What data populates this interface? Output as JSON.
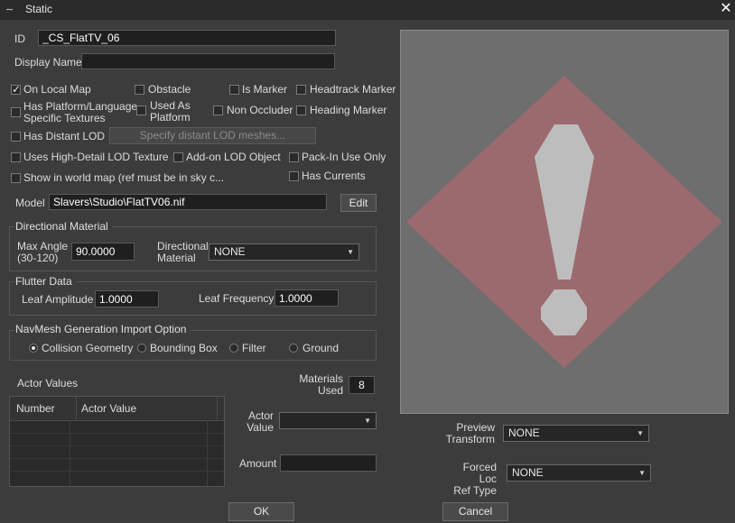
{
  "window": {
    "title": "Static",
    "close_glyph": "✕"
  },
  "form": {
    "id_label": "ID",
    "id_value": "_CS_FlatTV_06",
    "display_name_label": "Display Name",
    "display_name_value": ""
  },
  "checkboxes": {
    "on_local_map": {
      "label": "On Local Map",
      "checked": true
    },
    "obstacle": {
      "label": "Obstacle",
      "checked": false
    },
    "is_marker": {
      "label": "Is Marker",
      "checked": false
    },
    "headtrack_marker": {
      "label": "Headtrack Marker",
      "checked": false
    },
    "has_platform_language": {
      "label_line1": "Has Platform/Language",
      "label_line2": "Specific Textures",
      "checked": false
    },
    "used_as_platform": {
      "label_line1": "Used As",
      "label_line2": "Platform",
      "checked": false
    },
    "non_occluder": {
      "label": "Non Occluder",
      "checked": false
    },
    "heading_marker": {
      "label": "Heading Marker",
      "checked": false
    },
    "has_distant_lod": {
      "label": "Has Distant LOD",
      "checked": false
    },
    "uses_high_detail_lod": {
      "label": "Uses High-Detail LOD Texture",
      "checked": false
    },
    "addon_lod_object": {
      "label": "Add-on LOD Object",
      "checked": false
    },
    "pack_in_use_only": {
      "label": "Pack-In Use Only",
      "checked": false
    },
    "show_in_world_map": {
      "label": "Show in world map (ref must be in sky c...",
      "checked": false
    },
    "has_currents": {
      "label": "Has Currents",
      "checked": false
    }
  },
  "buttons": {
    "specify_lod": "Specify distant LOD meshes...",
    "edit": "Edit",
    "ok": "OK",
    "cancel": "Cancel"
  },
  "model": {
    "label": "Model",
    "value": "Slavers\\Studio\\FlatTV06.nif"
  },
  "directional_material": {
    "title": "Directional Material",
    "max_angle_label_line1": "Max Angle",
    "max_angle_label_line2": "(30-120)",
    "max_angle_value": "90.0000",
    "material_label_line1": "Directional",
    "material_label_line2": "Material",
    "material_value": "NONE"
  },
  "flutter": {
    "title": "Flutter Data",
    "leaf_amplitude_label": "Leaf Amplitude",
    "leaf_amplitude_value": "1.0000",
    "leaf_frequency_label": "Leaf Frequency",
    "leaf_frequency_value": "1.0000"
  },
  "navmesh": {
    "title": "NavMesh Generation Import Option",
    "options": [
      "Collision Geometry",
      "Bounding Box",
      "Filter",
      "Ground"
    ],
    "selected": "Collision Geometry"
  },
  "actor_values": {
    "title": "Actor Values",
    "columns": [
      "Number",
      "Actor Value"
    ],
    "rows": [],
    "materials_used_label_line1": "Materials",
    "materials_used_label_line2": "Used",
    "materials_used_value": "8",
    "actor_value_label_line1": "Actor",
    "actor_value_label_line2": "Value",
    "actor_value_selected": "",
    "amount_label": "Amount",
    "amount_value": ""
  },
  "preview": {
    "transform_label_line1": "Preview",
    "transform_label_line2": "Transform",
    "transform_value": "NONE",
    "forced_loc_label_line1": "Forced Loc",
    "forced_loc_label_line2": "Ref Type",
    "forced_loc_value": "NONE",
    "icon": "warning-exclamation-icon"
  },
  "colors": {
    "background": "#3c3c3c",
    "preview_bg": "#6e6e6e",
    "diamond": "#9b6a6e",
    "exclamation": "#bdbdbd"
  }
}
